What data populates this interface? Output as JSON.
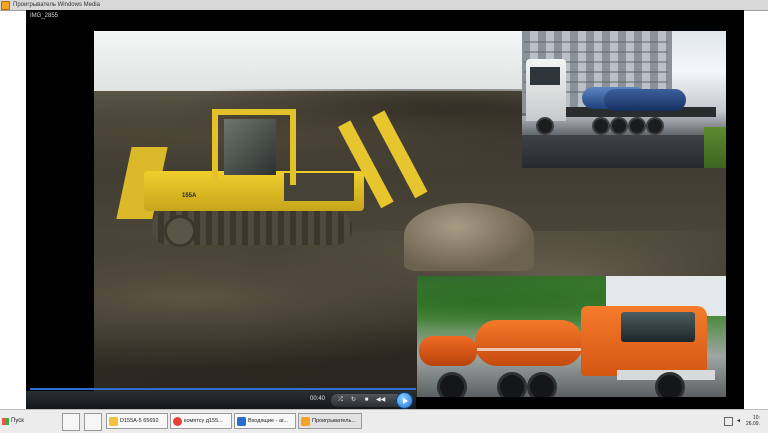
{
  "window": {
    "title": "Проигрыватель Windows Media",
    "file_name": "IMG_2855"
  },
  "video": {
    "dozer_model": "155A"
  },
  "player": {
    "time": "00:40",
    "progress": 1.0,
    "controls": {
      "shuffle": "⤮",
      "repeat": "↻",
      "stop": "■",
      "prev": "◀◀",
      "next": "▶▶"
    }
  },
  "taskbar": {
    "start_label": "Пуск",
    "tasks": [
      {
        "label": "D155A-5 65692"
      },
      {
        "label": "комятсу д155..."
      },
      {
        "label": "Входящие - аг..."
      },
      {
        "label": "Проигрыватель..."
      }
    ],
    "clock": {
      "time": "10:",
      "date": "26.09."
    }
  },
  "colors": {
    "accent": "#2b6fd1",
    "task_icons": [
      "#f0c040",
      "#e94235",
      "#2a6bcf",
      "#f4a425"
    ]
  }
}
